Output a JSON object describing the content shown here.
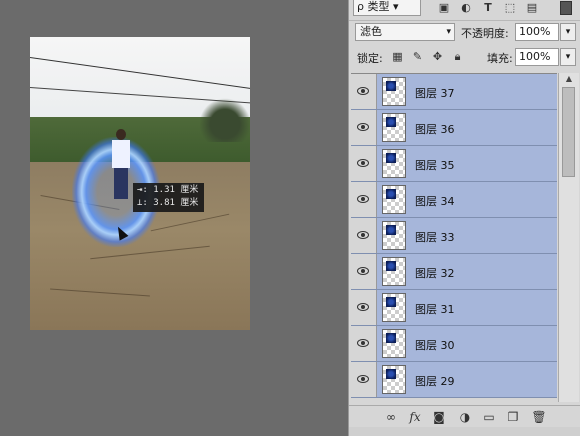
{
  "canvas": {
    "tooltip": {
      "line1": "⇥: 1.31 厘米",
      "line2": "⊥: 3.81 厘米"
    }
  },
  "panel": {
    "filter": {
      "label": "ρ 类型",
      "arrow": "▾"
    },
    "filter_icons": [
      "image-filter-icon",
      "adjustment-filter-icon",
      "type-filter-icon",
      "shape-filter-icon",
      "smart-object-filter-icon"
    ],
    "blend_mode": "滤色",
    "opacity_label": "不透明度:",
    "opacity_value": "100%",
    "lock_label": "锁定:",
    "fill_label": "填充:",
    "fill_value": "100%",
    "dropdown_arrow": "▾",
    "layers": [
      {
        "name": "图层 37"
      },
      {
        "name": "图层 36"
      },
      {
        "name": "图层 35"
      },
      {
        "name": "图层 34"
      },
      {
        "name": "图层 33"
      },
      {
        "name": "图层 32"
      },
      {
        "name": "图层 31"
      },
      {
        "name": "图层 30"
      },
      {
        "name": "图层 29"
      }
    ],
    "bottom_icons": [
      "link-layers-icon",
      "fx-icon",
      "mask-icon",
      "adjustment-layer-icon",
      "group-folder-icon",
      "new-layer-icon",
      "trash-icon"
    ]
  }
}
